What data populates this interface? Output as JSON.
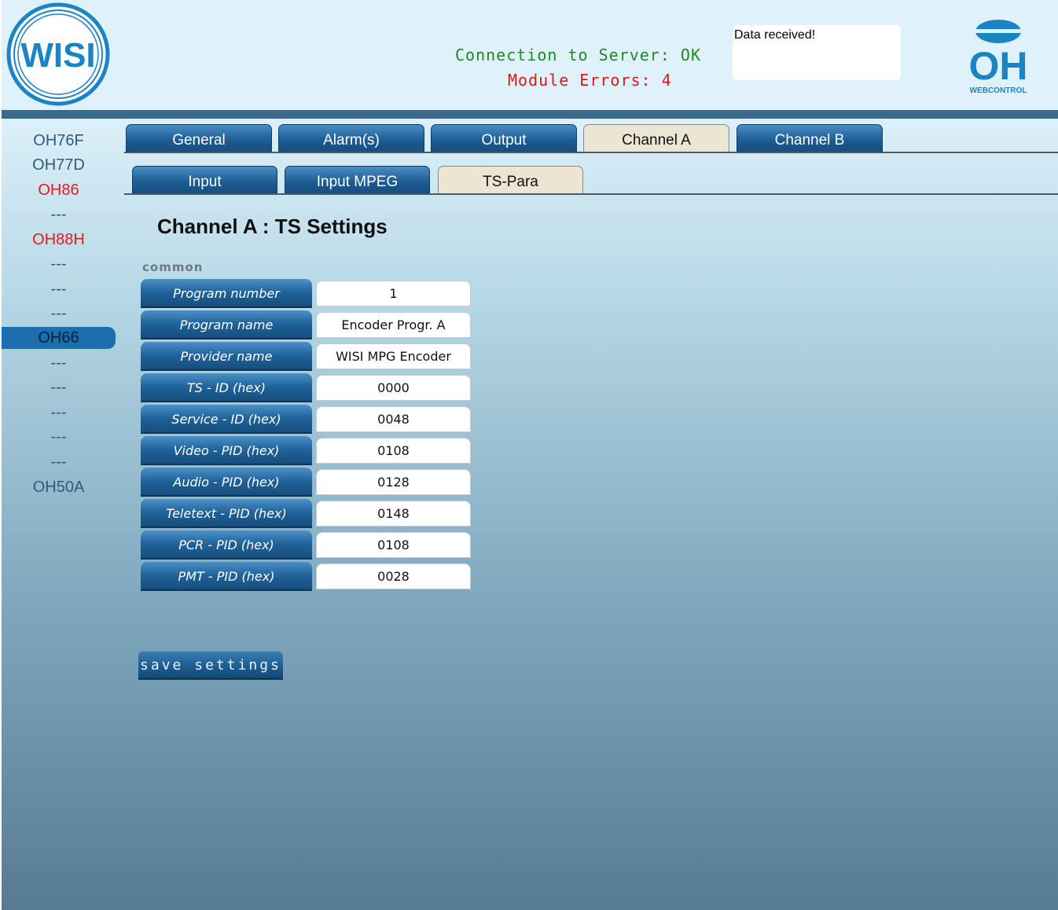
{
  "header": {
    "connection_status": "Connection to Server: OK",
    "module_errors": "Module Errors: 4",
    "message": "Data received!",
    "logo_left_text": "WISI",
    "logo_right_main": "OH",
    "logo_right_sub": "WEBCONTROL"
  },
  "sidebar": {
    "items": [
      {
        "label": "OH76F",
        "state": "normal"
      },
      {
        "label": "OH77D",
        "state": "normal"
      },
      {
        "label": "OH86",
        "state": "error"
      },
      {
        "label": "---",
        "state": "normal"
      },
      {
        "label": "OH88H",
        "state": "error"
      },
      {
        "label": "---",
        "state": "normal"
      },
      {
        "label": "---",
        "state": "normal"
      },
      {
        "label": "---",
        "state": "normal"
      },
      {
        "label": "OH66",
        "state": "selected"
      },
      {
        "label": "---",
        "state": "normal"
      },
      {
        "label": "---",
        "state": "normal"
      },
      {
        "label": "---",
        "state": "normal"
      },
      {
        "label": "---",
        "state": "normal"
      },
      {
        "label": "---",
        "state": "normal"
      },
      {
        "label": "OH50A",
        "state": "normal"
      }
    ]
  },
  "tabs": {
    "main": [
      "General",
      "Alarm(s)",
      "Output",
      "Channel A",
      "Channel B"
    ],
    "main_active": "Channel A",
    "sub": [
      "Input",
      "Input MPEG",
      "TS-Para"
    ],
    "sub_active": "TS-Para"
  },
  "page": {
    "title": "Channel A : TS Settings",
    "section": "common",
    "fields": [
      {
        "label": "Program number",
        "value": "1"
      },
      {
        "label": "Program name",
        "value": "Encoder Progr. A"
      },
      {
        "label": "Provider name",
        "value": "WISI MPG Encoder"
      },
      {
        "label": "TS - ID (hex)",
        "value": "0000"
      },
      {
        "label": "Service - ID (hex)",
        "value": "0048"
      },
      {
        "label": "Video - PID (hex)",
        "value": "0108"
      },
      {
        "label": "Audio - PID (hex)",
        "value": "0128"
      },
      {
        "label": "Teletext - PID (hex)",
        "value": "0148"
      },
      {
        "label": "PCR - PID (hex)",
        "value": "0108"
      },
      {
        "label": "PMT - PID (hex)",
        "value": "0028"
      }
    ],
    "save_label": "save settings"
  },
  "colors": {
    "ok": "#1f8a1f",
    "error": "#e01616",
    "accent": "#1c6eae"
  }
}
